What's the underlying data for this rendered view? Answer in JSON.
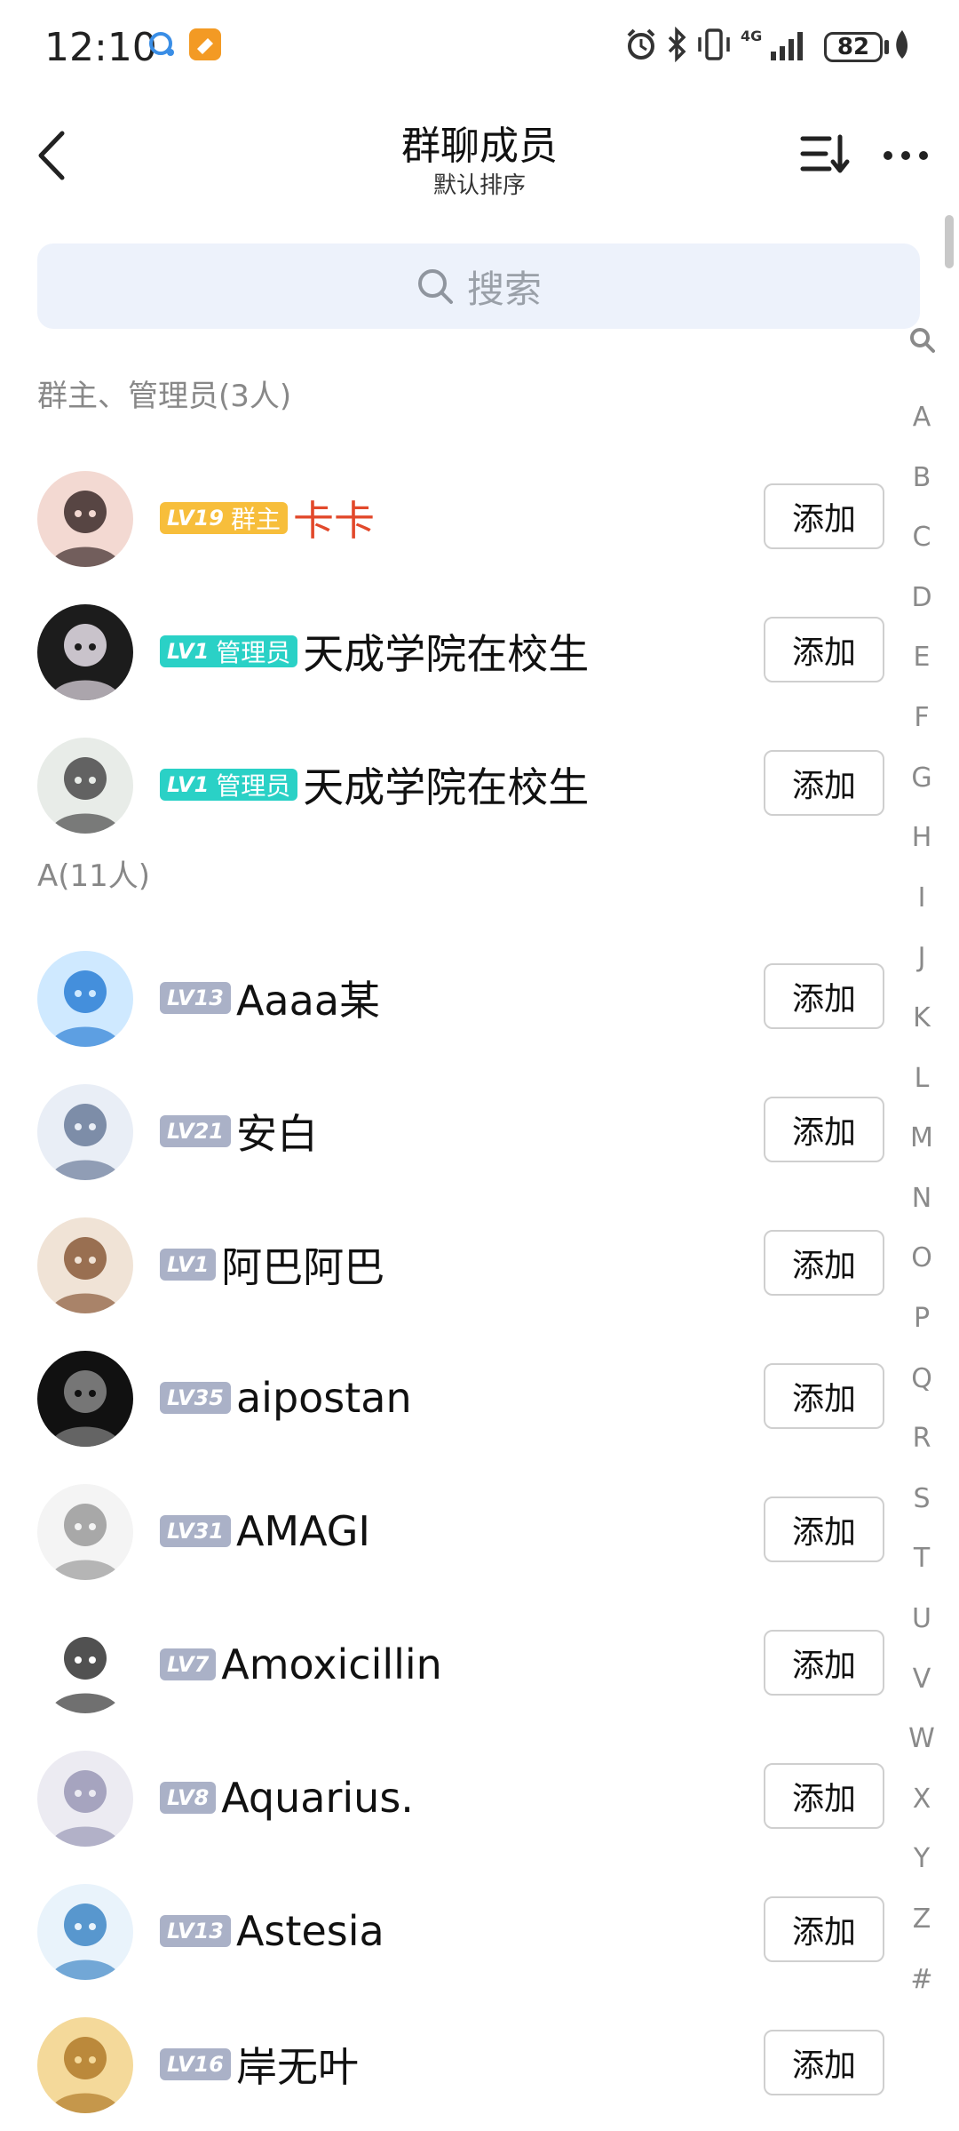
{
  "status_bar": {
    "time": "12:10",
    "battery": "82",
    "network": "4G"
  },
  "header": {
    "title": "群聊成员",
    "subtitle": "默认排序"
  },
  "search": {
    "placeholder": "搜索"
  },
  "index_letters": [
    "A",
    "B",
    "C",
    "D",
    "E",
    "F",
    "G",
    "H",
    "I",
    "J",
    "K",
    "L",
    "M",
    "N",
    "O",
    "P",
    "Q",
    "R",
    "S",
    "T",
    "U",
    "V",
    "W",
    "X",
    "Y",
    "Z",
    "#"
  ],
  "sections": [
    {
      "title": "群主、管理员(3人)",
      "members": [
        {
          "level": "LV19",
          "role": "群主",
          "role_style": "gold",
          "name": "卡卡",
          "owner": true,
          "action": "添加"
        },
        {
          "level": "LV1",
          "role": "管理员",
          "role_style": "teal",
          "name": "天成学院在校生",
          "action": "添加"
        },
        {
          "level": "LV1",
          "role": "管理员",
          "role_style": "teal",
          "name": "天成学院在校生",
          "action": "添加"
        }
      ]
    },
    {
      "title": "A(11人)",
      "members": [
        {
          "level": "LV13",
          "name": "Aaaa某",
          "action": "添加"
        },
        {
          "level": "LV21",
          "name": "安白",
          "action": "添加"
        },
        {
          "level": "LV1",
          "name": "阿巴阿巴",
          "action": "添加"
        },
        {
          "level": "LV35",
          "name": "aipostan",
          "action": "添加"
        },
        {
          "level": "LV31",
          "name": "AMAGI",
          "action": "添加"
        },
        {
          "level": "LV7",
          "name": "Amoxicillin",
          "action": "添加"
        },
        {
          "level": "LV8",
          "name": "Aquarius.",
          "action": "添加"
        },
        {
          "level": "LV13",
          "name": "Astesia",
          "action": "添加"
        },
        {
          "level": "LV16",
          "name": "岸无叶",
          "action": "添加"
        }
      ]
    }
  ],
  "colors": {
    "accent_gold": "#f7be3b",
    "accent_teal": "#2ad1c6",
    "owner_name": "#e2492b",
    "level_gray": "#aab1c7",
    "search_bg": "#edf2fb"
  },
  "icons": [
    "back-icon",
    "sort-icon",
    "more-icon",
    "search-icon",
    "alarm-icon",
    "bluetooth-icon",
    "vibrate-icon",
    "signal-icon",
    "battery-icon"
  ]
}
